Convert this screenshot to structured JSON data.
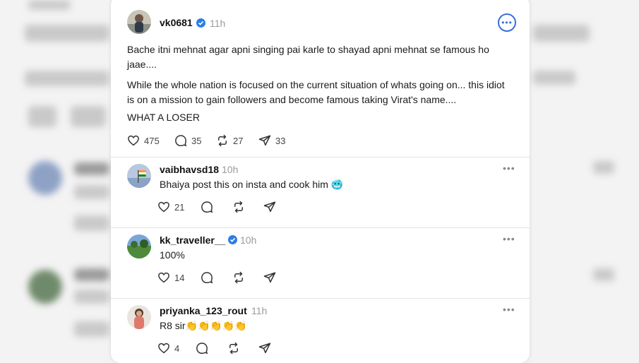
{
  "main_post": {
    "username": "vk0681",
    "time": "11h",
    "paragraph1": "Bache itni mehnat agar apni singing pai karle to shayad apni mehnat se famous ho jaae....",
    "paragraph2": "While the whole nation is focused on the current situation of whats going on... this idiot is on a mission to gain followers and become famous taking Virat's name....",
    "paragraph3": "WHAT A LOSER",
    "likes": "475",
    "comments": "35",
    "reposts": "27",
    "shares": "33"
  },
  "replies": [
    {
      "username": "vaibhavsd18",
      "time": "10h",
      "text": "Bhaiya post this on insta and cook him",
      "emoji": "🥶",
      "likes": "21"
    },
    {
      "username": "kk_traveller__",
      "time": "10h",
      "text": "100%",
      "likes": "14"
    },
    {
      "username": "priyanka_123_rout",
      "time": "11h",
      "text": "R8 sir",
      "emoji": "👏👏👏👏👏",
      "likes": "4"
    }
  ],
  "icons": {
    "like": "heart-icon",
    "comment": "comment-icon",
    "repost": "repost-icon",
    "share": "send-icon",
    "more": "more-options-icon",
    "verified": "verified-badge-icon"
  },
  "colors": {
    "verified": "#2b7de9",
    "more_ring": "#3a6fd8",
    "muted": "#9a9a9a"
  }
}
